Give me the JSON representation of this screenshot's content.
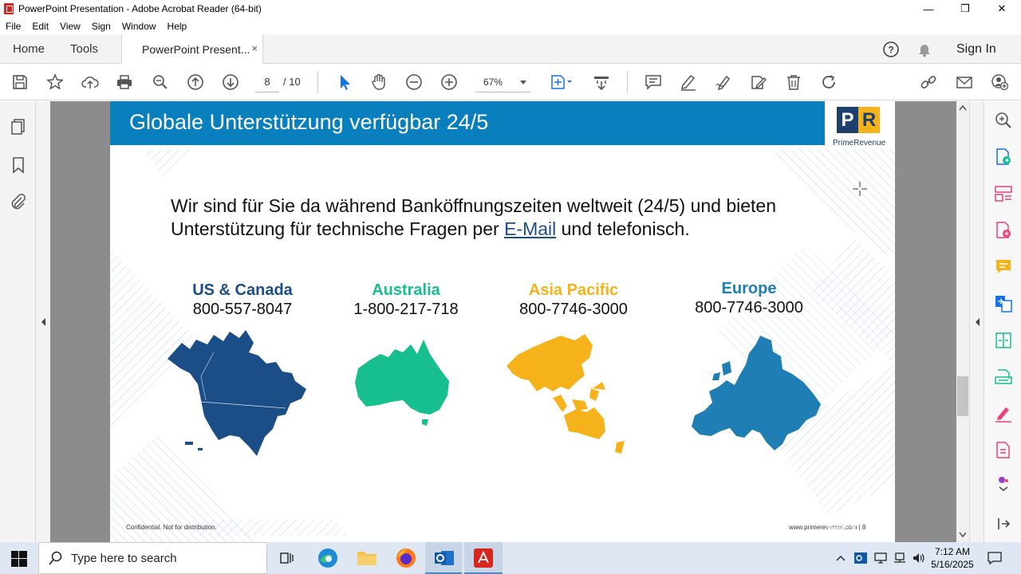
{
  "window": {
    "title": "PowerPoint Presentation - Adobe Acrobat Reader (64-bit)",
    "minimize": "—",
    "maximize": "❐",
    "close": "✕"
  },
  "menu": {
    "file": "File",
    "edit": "Edit",
    "view": "View",
    "sign": "Sign",
    "window": "Window",
    "help": "Help"
  },
  "tabs": {
    "home": "Home",
    "tools": "Tools",
    "document": "PowerPoint Present...",
    "close": "×",
    "sign_in": "Sign In"
  },
  "toolbar": {
    "page_current": "8",
    "page_total": "/  10",
    "zoom": "67%"
  },
  "slide": {
    "title": "Globale Unterstützung verfügbar 24/5",
    "logo_p": "P",
    "logo_r": "R",
    "logo_name": "PrimeRevenue",
    "intro_before": "Wir sind für Sie da während Banköffnungszeiten weltweit (24/5) und bieten Unterstützung für technische Fragen per ",
    "intro_link": "E-Mail",
    "intro_after": " und telefonisch.",
    "regions": [
      {
        "name": "US & Canada",
        "phone": "800-557-8047",
        "color": "#1b4d86"
      },
      {
        "name": "Australia",
        "phone": "1-800-217-718",
        "color": "#17bf8e"
      },
      {
        "name": "Asia Pacific",
        "phone": "800-7746-3000",
        "color": "#f5b21a"
      },
      {
        "name": "Europe",
        "phone": "800-7746-3000",
        "color": "#1f7fb5"
      }
    ],
    "footer_left": "Confidential. Not for distribution.",
    "footer_right": "www.primerevenue.com | 8"
  },
  "watermark": "ANY RUN",
  "taskbar": {
    "search_placeholder": "Type here to search",
    "time": "7:12 AM",
    "date": "5/16/2025"
  },
  "colors": {
    "header_blue": "#0a7fbd",
    "acrobat_red": "#d7261e",
    "icon_blue": "#1473e6",
    "icon_pink": "#e8417c"
  }
}
